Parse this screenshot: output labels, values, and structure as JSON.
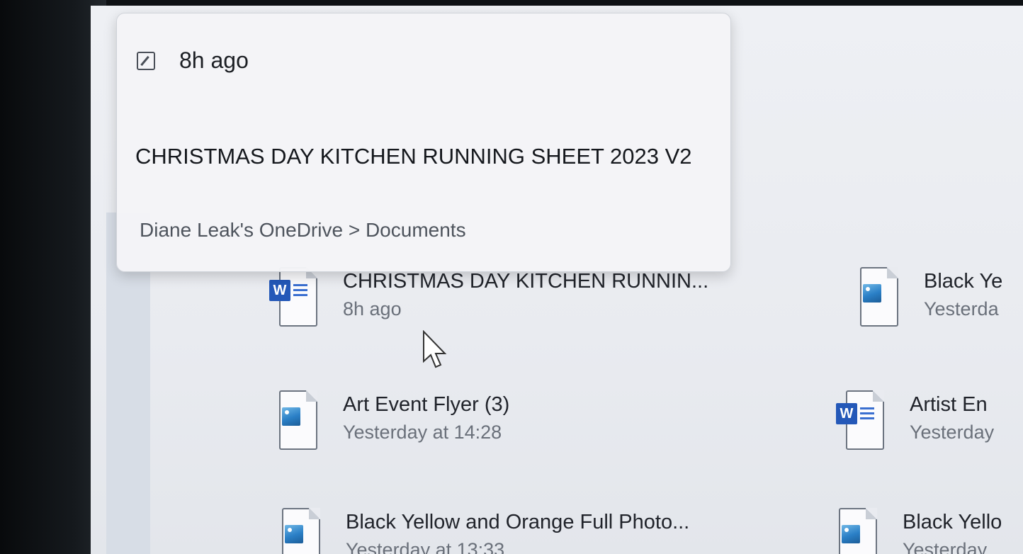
{
  "tooltip": {
    "time": "8h ago",
    "title": "CHRISTMAS DAY KITCHEN RUNNING SHEET 2023 V2",
    "path": "Diane Leak's OneDrive > Documents"
  },
  "files": [
    {
      "name": "CHRISTMAS DAY KITCHEN RUNNIN...",
      "time": "8h ago",
      "icon": "word-doc-icon"
    },
    {
      "name": "Black Ye",
      "time": "Yesterda",
      "icon": "image-file-icon"
    },
    {
      "name": "Art Event Flyer (3)",
      "time": "Yesterday at 14:28",
      "icon": "image-file-icon"
    },
    {
      "name": "Artist En",
      "time": "Yesterday",
      "icon": "word-doc-icon"
    },
    {
      "name": "Black Yellow and Orange Full Photo...",
      "time": "Yesterday at 13:33",
      "icon": "image-file-icon"
    },
    {
      "name": "Black Yello",
      "time": "Yesterday",
      "icon": "image-file-icon"
    }
  ],
  "word_badge": "W"
}
